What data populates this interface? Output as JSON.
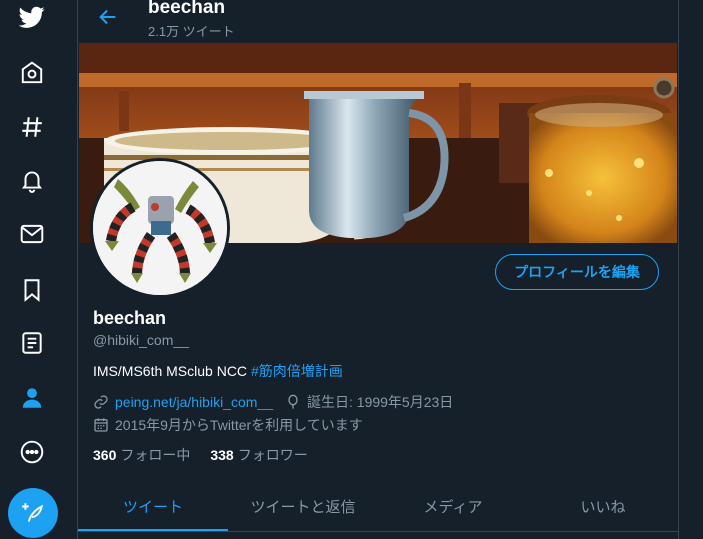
{
  "header": {
    "title": "beechan",
    "tweet_count": "2.1万 ツイート"
  },
  "profile": {
    "edit_button": "プロフィールを編集",
    "name": "beechan",
    "handle": "@hibiki_com__",
    "bio_text": "IMS/MS6th MSclub NCC ",
    "bio_hashtag": "#筋肉倍増計画",
    "link": "peing.net/ja/hibiki_com__",
    "birthday": "誕生日: 1999年5月23日",
    "joined": "2015年9月からTwitterを利用しています",
    "following_count": "360",
    "following_label": "フォロー中",
    "followers_count": "338",
    "followers_label": "フォロワー"
  },
  "tabs": [
    {
      "label": "ツイート",
      "active": true
    },
    {
      "label": "ツイートと返信",
      "active": false
    },
    {
      "label": "メディア",
      "active": false
    },
    {
      "label": "いいね",
      "active": false
    }
  ],
  "nav": [
    "twitter-logo",
    "home",
    "explore",
    "notifications",
    "messages",
    "bookmarks",
    "lists",
    "profile",
    "more",
    "tweet"
  ],
  "colors": {
    "background": "#15202b",
    "accent": "#1da1f2",
    "secondary_text": "#8899a6",
    "border": "#38444d"
  }
}
